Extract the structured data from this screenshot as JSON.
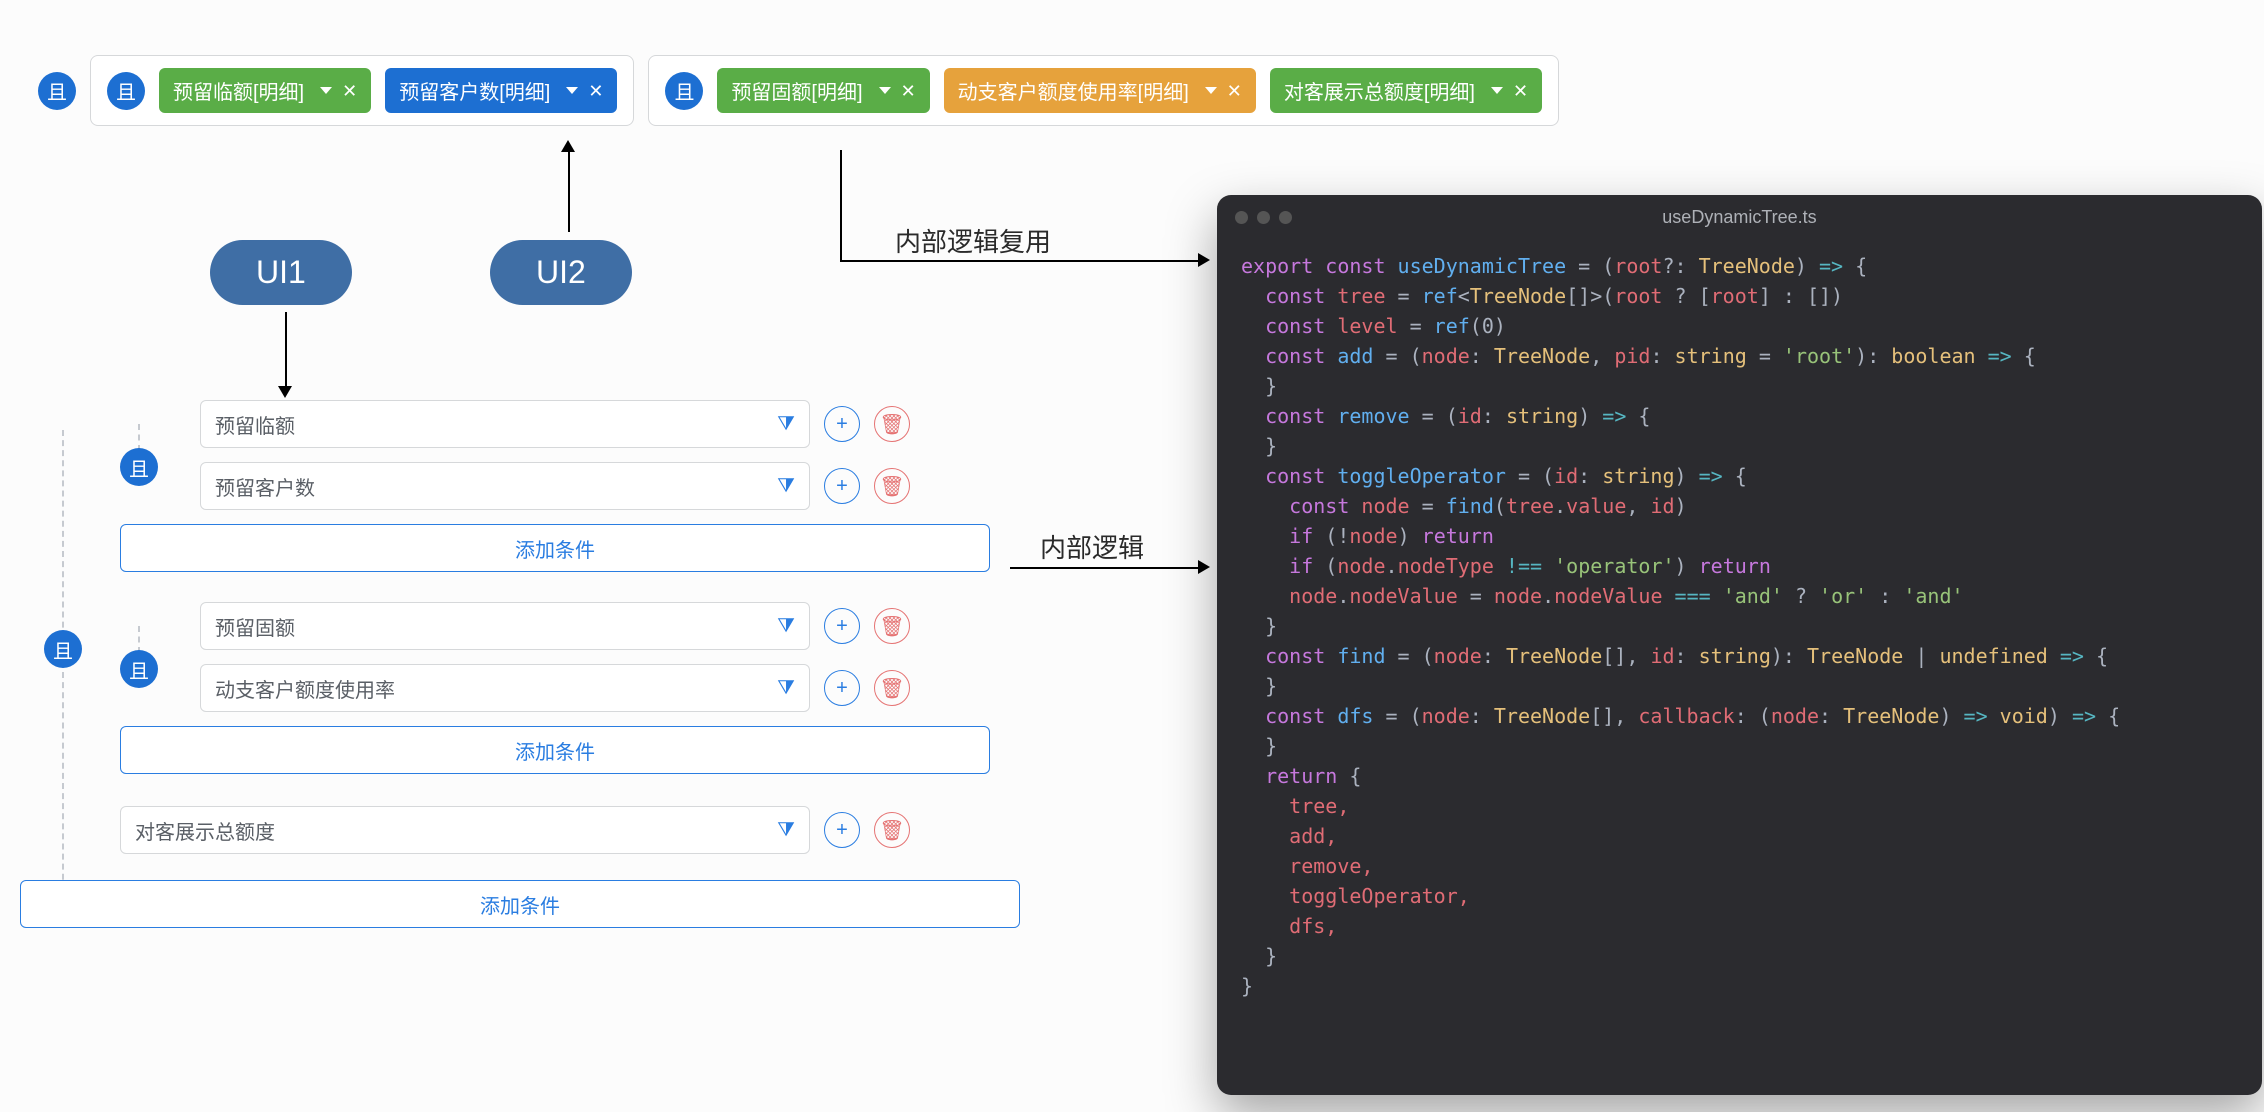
{
  "top": {
    "outer_op": "且",
    "group1": {
      "op": "且",
      "tags": [
        {
          "label": "预留临额[明细]",
          "color": "green"
        },
        {
          "label": "预留客户数[明细]",
          "color": "blue"
        }
      ]
    },
    "group2": {
      "op": "且",
      "tags": [
        {
          "label": "预留固额[明细]",
          "color": "green"
        },
        {
          "label": "动支客户额度使用率[明细]",
          "color": "orange"
        },
        {
          "label": "对客展示总额度[明细]",
          "color": "green"
        }
      ]
    }
  },
  "ovals": {
    "ui1": "UI1",
    "ui2": "UI2"
  },
  "arrows": {
    "reuse": "内部逻辑复用",
    "inner": "内部逻辑"
  },
  "tree": {
    "outer_op": "且",
    "group1": {
      "op": "且",
      "items": [
        "预留临额",
        "预留客户数"
      ],
      "add": "添加条件"
    },
    "group2": {
      "op": "且",
      "items": [
        "预留固额",
        "动支客户额度使用率"
      ],
      "add": "添加条件"
    },
    "standalone": {
      "item": "对客展示总额度",
      "add": "添加条件"
    }
  },
  "code": {
    "filename": "useDynamicTree.ts",
    "lines": [
      {
        "t": "export const ",
        "k": "kw"
      },
      {
        "t": "useDynamicTree",
        "k": "fn"
      },
      {
        "t": " = (",
        "k": "punct"
      },
      {
        "t": "root",
        "k": "param"
      },
      {
        "t": "?: ",
        "k": "punct"
      },
      {
        "t": "TreeNode",
        "k": "type"
      },
      {
        "t": ") ",
        "k": "punct"
      },
      {
        "t": "=>",
        "k": "op"
      },
      {
        "t": " {",
        "k": "punct"
      },
      {
        "nl": 1
      },
      {
        "t": "  const ",
        "k": "kw"
      },
      {
        "t": "tree",
        "k": "prop"
      },
      {
        "t": " = ",
        "k": "punct"
      },
      {
        "t": "ref",
        "k": "fn"
      },
      {
        "t": "<",
        "k": "punct"
      },
      {
        "t": "TreeNode",
        "k": "type"
      },
      {
        "t": "[]>(",
        "k": "punct"
      },
      {
        "t": "root",
        "k": "param"
      },
      {
        "t": " ? [",
        "k": "punct"
      },
      {
        "t": "root",
        "k": "param"
      },
      {
        "t": "] : [])",
        "k": "punct"
      },
      {
        "nl": 1
      },
      {
        "t": "  const ",
        "k": "kw"
      },
      {
        "t": "level",
        "k": "prop"
      },
      {
        "t": " = ",
        "k": "punct"
      },
      {
        "t": "ref",
        "k": "fn"
      },
      {
        "t": "(0)",
        "k": "punct"
      },
      {
        "nl": 1
      },
      {
        "t": "  const ",
        "k": "kw"
      },
      {
        "t": "add",
        "k": "fn"
      },
      {
        "t": " = (",
        "k": "punct"
      },
      {
        "t": "node",
        "k": "param"
      },
      {
        "t": ": ",
        "k": "punct"
      },
      {
        "t": "TreeNode",
        "k": "type"
      },
      {
        "t": ", ",
        "k": "punct"
      },
      {
        "t": "pid",
        "k": "param"
      },
      {
        "t": ": ",
        "k": "punct"
      },
      {
        "t": "string",
        "k": "type"
      },
      {
        "t": " = ",
        "k": "punct"
      },
      {
        "t": "'root'",
        "k": "str"
      },
      {
        "t": "): ",
        "k": "punct"
      },
      {
        "t": "boolean",
        "k": "type"
      },
      {
        "t": " ",
        "k": "punct"
      },
      {
        "t": "=>",
        "k": "op"
      },
      {
        "t": " {",
        "k": "punct"
      },
      {
        "nl": 1
      },
      {
        "t": "  }",
        "k": "punct"
      },
      {
        "nl": 1
      },
      {
        "t": "  const ",
        "k": "kw"
      },
      {
        "t": "remove",
        "k": "fn"
      },
      {
        "t": " = (",
        "k": "punct"
      },
      {
        "t": "id",
        "k": "param"
      },
      {
        "t": ": ",
        "k": "punct"
      },
      {
        "t": "string",
        "k": "type"
      },
      {
        "t": ") ",
        "k": "punct"
      },
      {
        "t": "=>",
        "k": "op"
      },
      {
        "t": " {",
        "k": "punct"
      },
      {
        "nl": 1
      },
      {
        "t": "  }",
        "k": "punct"
      },
      {
        "nl": 1
      },
      {
        "t": "  const ",
        "k": "kw"
      },
      {
        "t": "toggleOperator",
        "k": "fn"
      },
      {
        "t": " = (",
        "k": "punct"
      },
      {
        "t": "id",
        "k": "param"
      },
      {
        "t": ": ",
        "k": "punct"
      },
      {
        "t": "string",
        "k": "type"
      },
      {
        "t": ") ",
        "k": "punct"
      },
      {
        "t": "=>",
        "k": "op"
      },
      {
        "t": " {",
        "k": "punct"
      },
      {
        "nl": 1
      },
      {
        "t": "    const ",
        "k": "kw"
      },
      {
        "t": "node",
        "k": "prop"
      },
      {
        "t": " = ",
        "k": "punct"
      },
      {
        "t": "find",
        "k": "fn"
      },
      {
        "t": "(",
        "k": "punct"
      },
      {
        "t": "tree",
        "k": "prop"
      },
      {
        "t": ".",
        "k": "punct"
      },
      {
        "t": "value",
        "k": "prop"
      },
      {
        "t": ", ",
        "k": "punct"
      },
      {
        "t": "id",
        "k": "param"
      },
      {
        "t": ")",
        "k": "punct"
      },
      {
        "nl": 1
      },
      {
        "t": "    if ",
        "k": "kw"
      },
      {
        "t": "(!",
        "k": "punct"
      },
      {
        "t": "node",
        "k": "prop"
      },
      {
        "t": ") ",
        "k": "punct"
      },
      {
        "t": "return",
        "k": "kw"
      },
      {
        "nl": 1
      },
      {
        "t": "    if ",
        "k": "kw"
      },
      {
        "t": "(",
        "k": "punct"
      },
      {
        "t": "node",
        "k": "prop"
      },
      {
        "t": ".",
        "k": "punct"
      },
      {
        "t": "nodeType",
        "k": "prop"
      },
      {
        "t": " !== ",
        "k": "op"
      },
      {
        "t": "'operator'",
        "k": "str"
      },
      {
        "t": ") ",
        "k": "punct"
      },
      {
        "t": "return",
        "k": "kw"
      },
      {
        "nl": 1
      },
      {
        "t": "    ",
        "k": "punct"
      },
      {
        "t": "node",
        "k": "prop"
      },
      {
        "t": ".",
        "k": "punct"
      },
      {
        "t": "nodeValue",
        "k": "prop"
      },
      {
        "t": " = ",
        "k": "punct"
      },
      {
        "t": "node",
        "k": "prop"
      },
      {
        "t": ".",
        "k": "punct"
      },
      {
        "t": "nodeValue",
        "k": "prop"
      },
      {
        "t": " === ",
        "k": "op"
      },
      {
        "t": "'and'",
        "k": "str"
      },
      {
        "t": " ? ",
        "k": "punct"
      },
      {
        "t": "'or'",
        "k": "str"
      },
      {
        "t": " : ",
        "k": "punct"
      },
      {
        "t": "'and'",
        "k": "str"
      },
      {
        "nl": 1
      },
      {
        "t": "  }",
        "k": "punct"
      },
      {
        "nl": 1
      },
      {
        "t": "  const ",
        "k": "kw"
      },
      {
        "t": "find",
        "k": "fn"
      },
      {
        "t": " = (",
        "k": "punct"
      },
      {
        "t": "node",
        "k": "param"
      },
      {
        "t": ": ",
        "k": "punct"
      },
      {
        "t": "TreeNode",
        "k": "type"
      },
      {
        "t": "[], ",
        "k": "punct"
      },
      {
        "t": "id",
        "k": "param"
      },
      {
        "t": ": ",
        "k": "punct"
      },
      {
        "t": "string",
        "k": "type"
      },
      {
        "t": "): ",
        "k": "punct"
      },
      {
        "t": "TreeNode",
        "k": "type"
      },
      {
        "t": " | ",
        "k": "punct"
      },
      {
        "t": "undefined",
        "k": "type"
      },
      {
        "t": " ",
        "k": "punct"
      },
      {
        "t": "=>",
        "k": "op"
      },
      {
        "t": " {",
        "k": "punct"
      },
      {
        "nl": 1
      },
      {
        "t": "  }",
        "k": "punct"
      },
      {
        "nl": 1
      },
      {
        "t": "  const ",
        "k": "kw"
      },
      {
        "t": "dfs",
        "k": "fn"
      },
      {
        "t": " = (",
        "k": "punct"
      },
      {
        "t": "node",
        "k": "param"
      },
      {
        "t": ": ",
        "k": "punct"
      },
      {
        "t": "TreeNode",
        "k": "type"
      },
      {
        "t": "[], ",
        "k": "punct"
      },
      {
        "t": "callback",
        "k": "param"
      },
      {
        "t": ": (",
        "k": "punct"
      },
      {
        "t": "node",
        "k": "param"
      },
      {
        "t": ": ",
        "k": "punct"
      },
      {
        "t": "TreeNode",
        "k": "type"
      },
      {
        "t": ") ",
        "k": "punct"
      },
      {
        "t": "=>",
        "k": "op"
      },
      {
        "t": " ",
        "k": "punct"
      },
      {
        "t": "void",
        "k": "type"
      },
      {
        "t": ") ",
        "k": "punct"
      },
      {
        "t": "=>",
        "k": "op"
      },
      {
        "t": " {",
        "k": "punct"
      },
      {
        "nl": 1
      },
      {
        "t": "  }",
        "k": "punct"
      },
      {
        "nl": 1
      },
      {
        "t": "  return ",
        "k": "kw"
      },
      {
        "t": "{",
        "k": "punct"
      },
      {
        "nl": 1
      },
      {
        "t": "    tree,",
        "k": "prop"
      },
      {
        "nl": 1
      },
      {
        "t": "    add,",
        "k": "prop"
      },
      {
        "nl": 1
      },
      {
        "t": "    remove,",
        "k": "prop"
      },
      {
        "nl": 1
      },
      {
        "t": "    toggleOperator,",
        "k": "prop"
      },
      {
        "nl": 1
      },
      {
        "t": "    dfs,",
        "k": "prop"
      },
      {
        "nl": 1
      },
      {
        "t": "  }",
        "k": "punct"
      },
      {
        "nl": 1
      },
      {
        "t": "}",
        "k": "punct"
      }
    ]
  }
}
